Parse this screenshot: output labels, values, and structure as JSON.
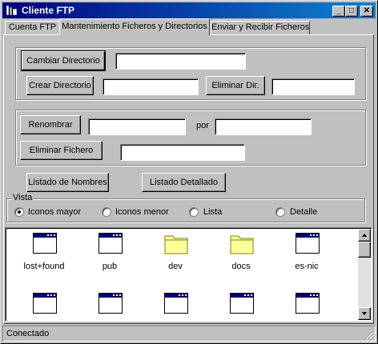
{
  "window": {
    "title": "Cliente FTP",
    "controls": {
      "minimize": "_",
      "maximize": "□",
      "close": "✕"
    }
  },
  "tabs": [
    {
      "label": "Cuenta FTP",
      "selected": false
    },
    {
      "label": "Mantenimiento Ficheros y Directorios",
      "selected": true
    },
    {
      "label": "Enviar y Recibir Ficheros",
      "selected": false
    }
  ],
  "directories": {
    "change_button": "Cambiar Directorio",
    "change_value": "",
    "create_button": "Crear Directorio",
    "create_value": "",
    "delete_button": "Eliminar Dir.",
    "delete_value": ""
  },
  "files": {
    "rename_button": "Renombrar",
    "rename_from_value": "",
    "por_label": "por",
    "rename_to_value": "",
    "delete_button": "Eliminar Fichero",
    "delete_value": ""
  },
  "listing": {
    "names_button": "Listado de Nombres",
    "detailed_button": "Listado Detallado"
  },
  "vista": {
    "title": "Vista",
    "options": [
      "Iconos mayor",
      "Iconos menor",
      "Lista",
      "Detalle"
    ],
    "selected": "Iconos mayor"
  },
  "list_items": [
    {
      "name": "lost+found",
      "icon": "window-icon"
    },
    {
      "name": "pub",
      "icon": "window-icon"
    },
    {
      "name": "dev",
      "icon": "folder-icon"
    },
    {
      "name": "docs",
      "icon": "folder-icon"
    },
    {
      "name": "es-nic",
      "icon": "window-icon"
    },
    {
      "name": "",
      "icon": "window-icon"
    },
    {
      "name": "",
      "icon": "window-icon"
    },
    {
      "name": "",
      "icon": "window-icon"
    },
    {
      "name": "",
      "icon": "window-icon"
    },
    {
      "name": "",
      "icon": "window-icon"
    }
  ],
  "status": {
    "text": "Conectado"
  },
  "colors": {
    "titlebar_start": "#000080",
    "titlebar_end": "#1084d0",
    "face": "#c0c0c0",
    "folder": "#ffff99"
  }
}
